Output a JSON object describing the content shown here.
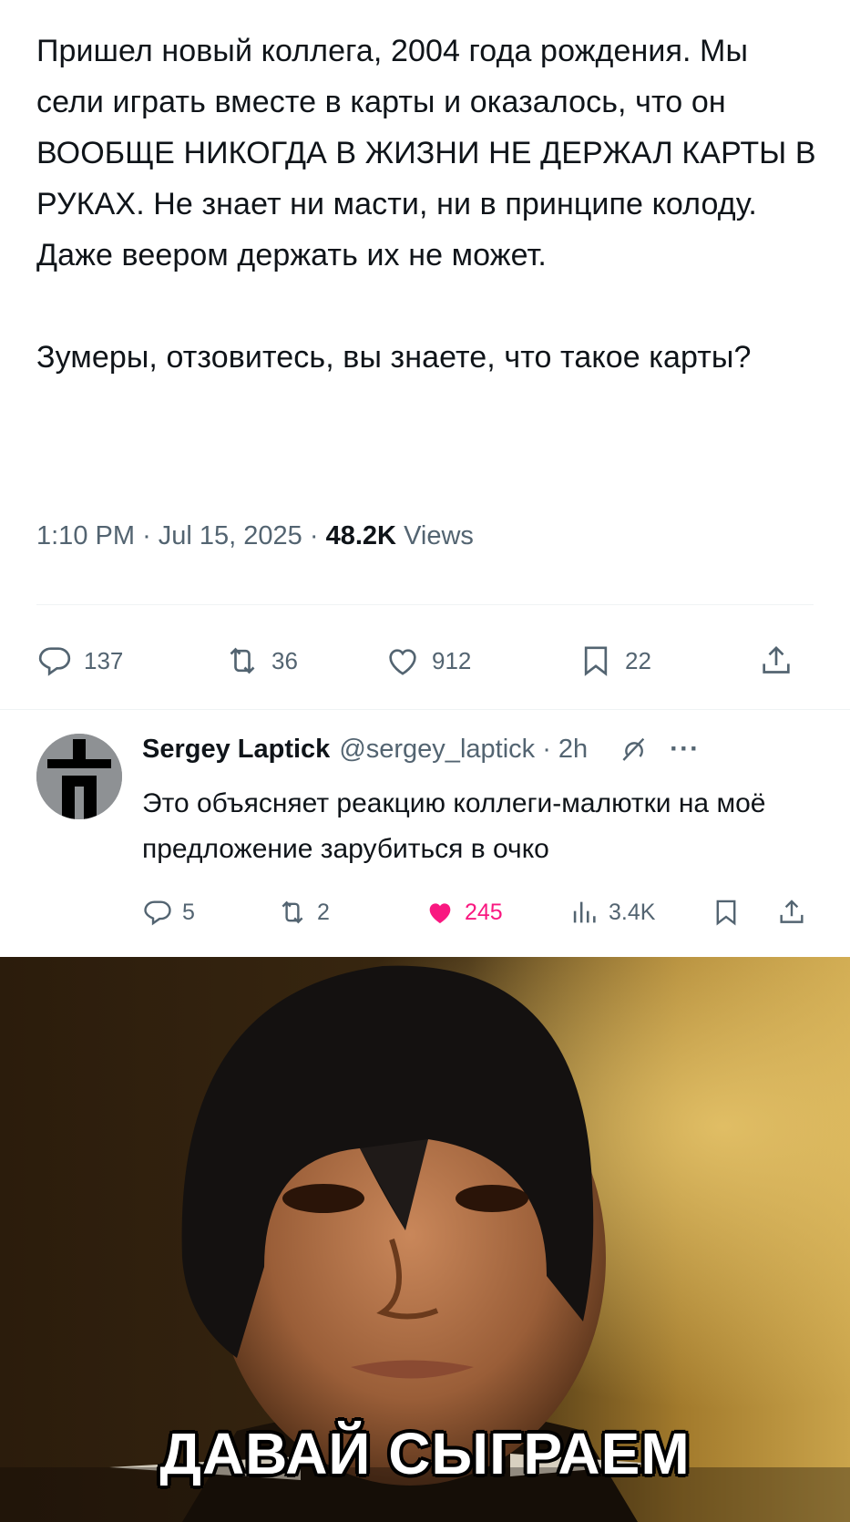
{
  "tweet": {
    "paragraphs": [
      "Пришел новый коллега, 2004 года рождения. Мы сели играть вместе в карты и оказалось, что он ВООБЩЕ НИКОГДА В ЖИЗНИ НЕ ДЕРЖАЛ КАРТЫ В РУКАХ. Не знает ни масти, ни в принципе колоду. Даже веером держать их не может.",
      "Зумеры, отзовитесь, вы знаете, что такое карты?"
    ],
    "time": "1:10 PM",
    "date": "Jul 15, 2025",
    "views_count": "48.2K",
    "views_label": "Views",
    "separator": "·",
    "actions": {
      "replies": "137",
      "reposts": "36",
      "likes": "912",
      "bookmarks": "22"
    }
  },
  "reply": {
    "name": "Sergey Laptick",
    "handle": "@sergey_laptick · 2h",
    "more": "···",
    "text": "Это объясняет реакцию коллеги-малютки на моё предложение зарубиться в очко",
    "actions": {
      "replies": "5",
      "reposts": "2",
      "likes": "245",
      "views": "3.4K"
    },
    "like_color": "#f91880"
  },
  "meme": {
    "caption": "ДАВАЙ СЫГРАЕМ"
  },
  "colors": {
    "text_primary": "#0f1419",
    "text_secondary": "#536471",
    "divider": "#eff3f4"
  },
  "icons": [
    "reply-icon",
    "repost-icon",
    "heart-icon",
    "bookmark-icon",
    "share-icon",
    "grok-icon",
    "views-icon"
  ]
}
